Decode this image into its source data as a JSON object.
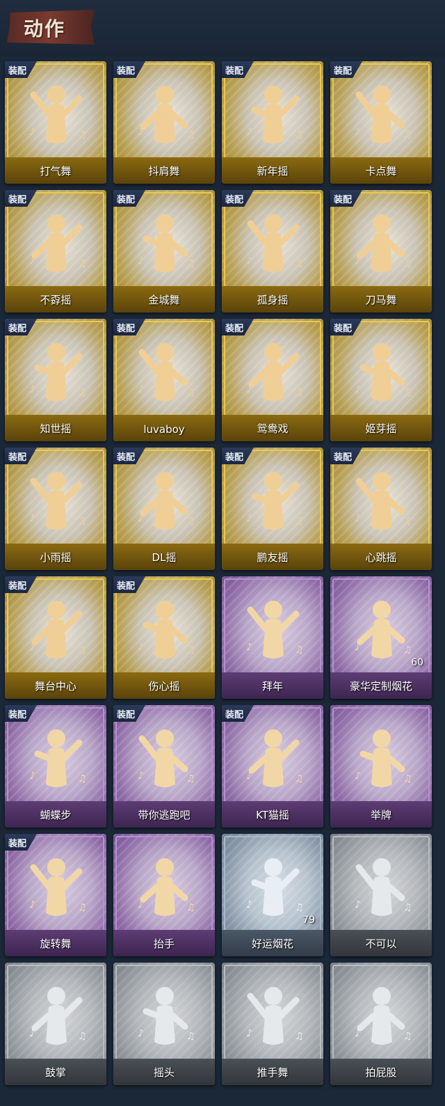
{
  "title": "动作",
  "equip_badge": "装配",
  "items": [
    {
      "label": "打气舞",
      "tier": "gold",
      "equipped": true
    },
    {
      "label": "抖肩舞",
      "tier": "gold",
      "equipped": true
    },
    {
      "label": "新年摇",
      "tier": "gold",
      "equipped": true
    },
    {
      "label": "卡点舞",
      "tier": "gold",
      "equipped": true
    },
    {
      "label": "不孬摇",
      "tier": "gold",
      "equipped": true
    },
    {
      "label": "金城舞",
      "tier": "gold",
      "equipped": true
    },
    {
      "label": "孤身摇",
      "tier": "gold",
      "equipped": true
    },
    {
      "label": "刀马舞",
      "tier": "gold",
      "equipped": true
    },
    {
      "label": "知世摇",
      "tier": "gold",
      "equipped": true
    },
    {
      "label": "luvaboy",
      "tier": "gold",
      "equipped": true
    },
    {
      "label": "鸳鸯戏",
      "tier": "gold",
      "equipped": true
    },
    {
      "label": "姬芽摇",
      "tier": "gold",
      "equipped": true
    },
    {
      "label": "小雨摇",
      "tier": "gold",
      "equipped": true
    },
    {
      "label": "DL摇",
      "tier": "gold",
      "equipped": true
    },
    {
      "label": "鹏友摇",
      "tier": "gold",
      "equipped": true
    },
    {
      "label": "心跳摇",
      "tier": "gold",
      "equipped": true
    },
    {
      "label": "舞台中心",
      "tier": "gold",
      "equipped": true
    },
    {
      "label": "伤心摇",
      "tier": "gold",
      "equipped": true
    },
    {
      "label": "拜年",
      "tier": "purple",
      "equipped": false
    },
    {
      "label": "豪华定制烟花",
      "tier": "purple",
      "equipped": false,
      "count": "60"
    },
    {
      "label": "蝴蝶步",
      "tier": "purple",
      "equipped": true
    },
    {
      "label": "带你逃跑吧",
      "tier": "purple",
      "equipped": true
    },
    {
      "label": "KT猫摇",
      "tier": "purple",
      "equipped": true
    },
    {
      "label": "举牌",
      "tier": "purple",
      "equipped": false
    },
    {
      "label": "旋转舞",
      "tier": "purple",
      "equipped": true
    },
    {
      "label": "抬手",
      "tier": "purple",
      "equipped": false
    },
    {
      "label": "好运烟花",
      "tier": "blue",
      "equipped": false,
      "count": "79"
    },
    {
      "label": "不可以",
      "tier": "gray",
      "equipped": false
    },
    {
      "label": "鼓掌",
      "tier": "gray",
      "equipped": false
    },
    {
      "label": "摇头",
      "tier": "gray",
      "equipped": false
    },
    {
      "label": "推手舞",
      "tier": "gray",
      "equipped": false
    },
    {
      "label": "拍屁股",
      "tier": "gray",
      "equipped": false
    }
  ]
}
